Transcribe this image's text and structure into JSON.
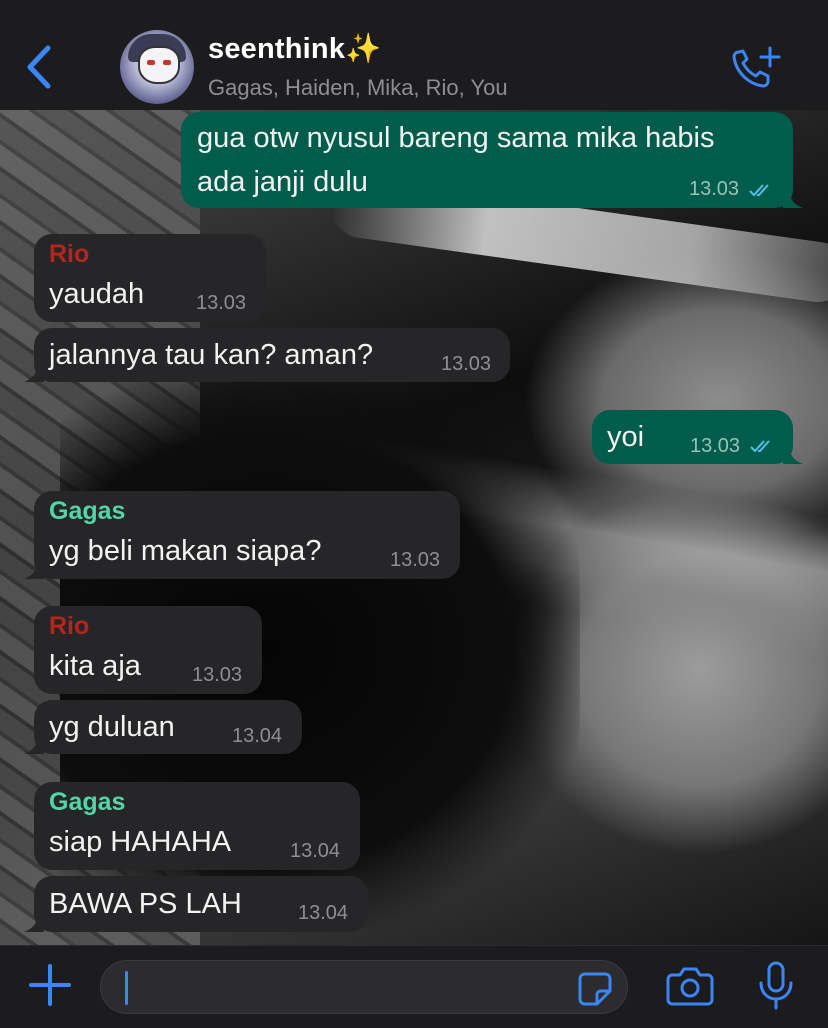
{
  "header": {
    "title": "seenthink✨",
    "members": "Gagas, Haiden, Mika, Rio, You",
    "back_icon": "chevron-left-icon",
    "call_icon": "add-call-icon"
  },
  "colors": {
    "accent": "#3b86f7",
    "incoming_bubble": "#262628",
    "outgoing_bubble": "#005c4b",
    "sender_rio": "#b3261e",
    "sender_gagas": "#52d6a6"
  },
  "messages": [
    {
      "direction": "out",
      "sender": "",
      "lines": [
        "gua otw nyusul bareng sama mika habis",
        "ada janji dulu"
      ],
      "time": "13.03",
      "read": true
    },
    {
      "direction": "in",
      "sender": "Rio",
      "lines": [
        "yaudah"
      ],
      "time": "13.03"
    },
    {
      "direction": "in",
      "sender": "",
      "lines": [
        "jalannya tau kan? aman?"
      ],
      "time": "13.03"
    },
    {
      "direction": "out",
      "sender": "",
      "lines": [
        "yoi"
      ],
      "time": "13.03",
      "read": true
    },
    {
      "direction": "in",
      "sender": "Gagas",
      "lines": [
        "yg beli makan siapa?"
      ],
      "time": "13.03"
    },
    {
      "direction": "in",
      "sender": "Rio",
      "lines": [
        "kita aja"
      ],
      "time": "13.03"
    },
    {
      "direction": "in",
      "sender": "",
      "lines": [
        "yg duluan"
      ],
      "time": "13.04"
    },
    {
      "direction": "in",
      "sender": "Gagas",
      "lines": [
        "siap HAHAHA"
      ],
      "time": "13.04"
    },
    {
      "direction": "in",
      "sender": "",
      "lines": [
        "BAWA PS LAH"
      ],
      "time": "13.04"
    }
  ],
  "composer": {
    "value": "",
    "plus_icon": "plus-icon",
    "sticker_icon": "sticker-icon",
    "camera_icon": "camera-icon",
    "mic_icon": "microphone-icon"
  }
}
